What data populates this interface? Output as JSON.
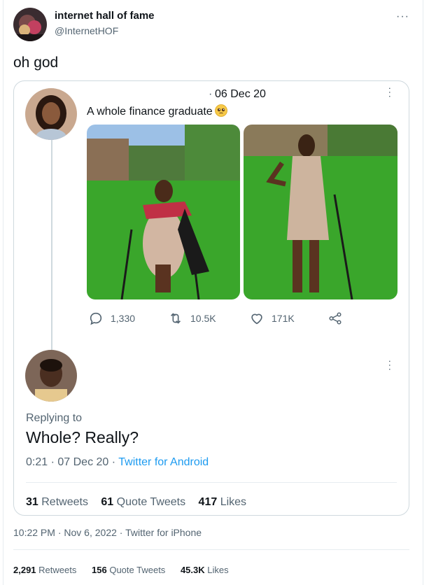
{
  "tweet": {
    "author_name": "internet hall of fame",
    "author_handle": "@InternetHOF",
    "text": "oh god",
    "time": "10:22 PM",
    "date": "Nov 6, 2022",
    "source": "Twitter for iPhone",
    "retweets": "2,291",
    "retweets_label": "Retweets",
    "quote_tweets": "156",
    "quote_tweets_label": "Quote Tweets",
    "likes": "45.3K",
    "likes_label": "Likes"
  },
  "quoted": {
    "date": "06 Dec 20",
    "text": "A whole finance graduate",
    "emoji": "pleading-face-emoji",
    "actions": {
      "replies": "1,330",
      "retweets": "10.5K",
      "likes": "171K"
    }
  },
  "reply": {
    "replying_to_label": "Replying to",
    "text": "Whole? Really?",
    "time": "0:21",
    "date": "07 Dec 20",
    "source": "Twitter for Android",
    "retweets": "31",
    "retweets_label": "Retweets",
    "quote_tweets": "61",
    "quote_tweets_label": "Quote Tweets",
    "likes": "417",
    "likes_label": "Likes"
  },
  "icons": [
    "more-icon",
    "reply-icon",
    "retweet-icon",
    "like-icon",
    "share-icon"
  ],
  "colors": {
    "link": "#1d9bf0",
    "secondary_text": "#536471",
    "border": "#cfd9de"
  }
}
